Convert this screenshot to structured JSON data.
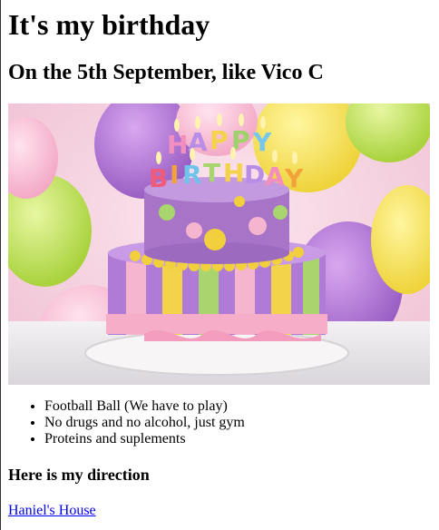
{
  "page": {
    "title": "It's my birthday",
    "subtitle": "On the 5th September, like Vico C"
  },
  "image": {
    "icon": "birthday-cake-image",
    "candle_letters_top": "HAPPY",
    "candle_letters_bottom": "BIRTHDAY",
    "colors": {
      "background_pink": "#f3c6d6",
      "balloon_purple": "#b77ad9",
      "balloon_yellow": "#f5e04a",
      "balloon_green": "#b9e04a",
      "cake_purple": "#a774c8",
      "cake_pink": "#f4aac6",
      "cake_yellow": "#f1cf3d",
      "cake_green": "#a7d46b",
      "table": "#e9e6ea"
    }
  },
  "list": {
    "items": [
      "Football Ball (We have to play)",
      "No drugs and no alcohol, just gym",
      "Proteins and suplements"
    ]
  },
  "direction": {
    "heading": "Here is my direction",
    "link_text": "Haniel's House",
    "link_color": "#0000ee"
  }
}
